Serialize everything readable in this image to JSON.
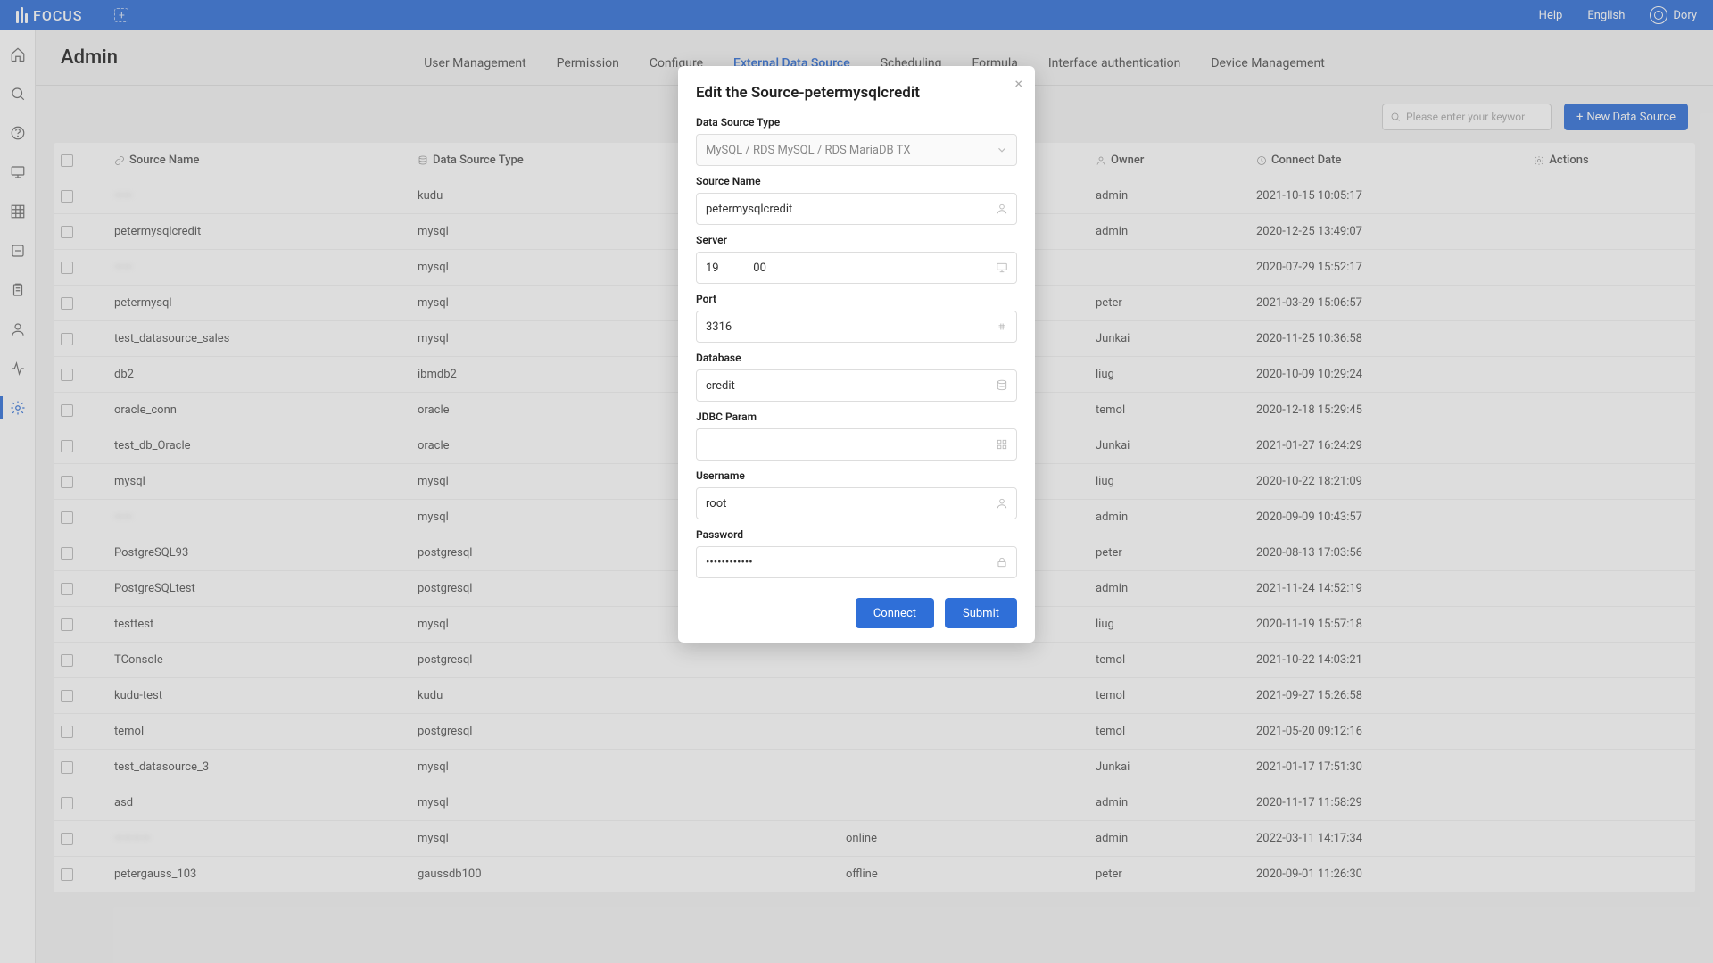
{
  "header": {
    "logo_text": "FOCUS",
    "help": "Help",
    "language": "English",
    "username": "Dory"
  },
  "page": {
    "title": "Admin"
  },
  "tabs": [
    {
      "label": "User Management"
    },
    {
      "label": "Permission"
    },
    {
      "label": "Configure"
    },
    {
      "label": "External Data Source"
    },
    {
      "label": "Scheduling"
    },
    {
      "label": "Formula"
    },
    {
      "label": "Interface authentication"
    },
    {
      "label": "Device Management"
    }
  ],
  "toolbar": {
    "search_placeholder": "Please enter your keywor",
    "new_button": "New Data Source"
  },
  "columns": {
    "source_name": "Source Name",
    "data_source_type": "Data Source Type",
    "connection_status": "",
    "owner": "Owner",
    "connect_date": "Connect Date",
    "actions": "Actions"
  },
  "rows": [
    {
      "name": "——",
      "name_blur": true,
      "type": "kudu",
      "status": "",
      "owner": "admin",
      "date": "2021-10-15 10:05:17"
    },
    {
      "name": "petermysqlcredit",
      "type": "mysql",
      "status": "",
      "owner": "admin",
      "date": "2020-12-25 13:49:07"
    },
    {
      "name": "——",
      "name_blur": true,
      "type": "mysql",
      "status": "",
      "owner": "",
      "date": "2020-07-29 15:52:17"
    },
    {
      "name": "petermysql",
      "type": "mysql",
      "status": "",
      "owner": "peter",
      "date": "2021-03-29 15:06:57"
    },
    {
      "name": "test_datasource_sales",
      "type": "mysql",
      "status": "",
      "owner": "Junkai",
      "date": "2020-11-25 10:36:58"
    },
    {
      "name": "db2",
      "type": "ibmdb2",
      "status": "",
      "owner": "liug",
      "date": "2020-10-09 10:29:24"
    },
    {
      "name": "oracle_conn",
      "type": "oracle",
      "status": "",
      "owner": "temol",
      "date": "2020-12-18 15:29:45"
    },
    {
      "name": "test_db_Oracle",
      "type": "oracle",
      "status": "",
      "owner": "Junkai",
      "date": "2021-01-27 16:24:29"
    },
    {
      "name": "mysql",
      "type": "mysql",
      "status": "",
      "owner": "liug",
      "date": "2020-10-22 18:21:09"
    },
    {
      "name": "——",
      "name_blur": true,
      "type": "mysql",
      "status": "",
      "owner": "admin",
      "date": "2020-09-09 10:43:57"
    },
    {
      "name": "PostgreSQL93",
      "type": "postgresql",
      "status": "",
      "owner": "peter",
      "date": "2020-08-13 17:03:56"
    },
    {
      "name": "PostgreSQLtest",
      "type": "postgresql",
      "status": "",
      "owner": "admin",
      "date": "2021-11-24 14:52:19"
    },
    {
      "name": "testtest",
      "type": "mysql",
      "status": "",
      "owner": "liug",
      "date": "2020-11-19 15:57:18"
    },
    {
      "name": "TConsole",
      "type": "postgresql",
      "status": "",
      "owner": "temol",
      "date": "2021-10-22 14:03:21"
    },
    {
      "name": "kudu-test",
      "type": "kudu",
      "status": "",
      "owner": "temol",
      "date": "2021-09-27 15:26:58"
    },
    {
      "name": "temol",
      "type": "postgresql",
      "status": "",
      "owner": "temol",
      "date": "2021-05-20 09:12:16"
    },
    {
      "name": "test_datasource_3",
      "type": "mysql",
      "status": "",
      "owner": "Junkai",
      "date": "2021-01-17 17:51:30"
    },
    {
      "name": "asd",
      "type": "mysql",
      "status": "",
      "owner": "admin",
      "date": "2020-11-17 11:58:29"
    },
    {
      "name": "————",
      "name_blur": true,
      "type": "mysql",
      "status": "online",
      "owner": "admin",
      "date": "2022-03-11 14:17:34"
    },
    {
      "name": "petergauss_103",
      "type": "gaussdb100",
      "status": "offline",
      "owner": "peter",
      "date": "2020-09-01 11:26:30"
    }
  ],
  "modal": {
    "title": "Edit the Source-petermysqlcredit",
    "labels": {
      "ds_type": "Data Source Type",
      "source_name": "Source Name",
      "server": "Server",
      "port": "Port",
      "database": "Database",
      "jdbc": "JDBC Param",
      "username": "Username",
      "password": "Password"
    },
    "values": {
      "ds_type": "MySQL / RDS MySQL / RDS MariaDB TX",
      "source_name": "petermysqlcredit",
      "server": "19            00",
      "port": "3316",
      "database": "credit",
      "jdbc": "",
      "username": "root",
      "password": "••••••••••••"
    },
    "buttons": {
      "connect": "Connect",
      "submit": "Submit"
    }
  }
}
